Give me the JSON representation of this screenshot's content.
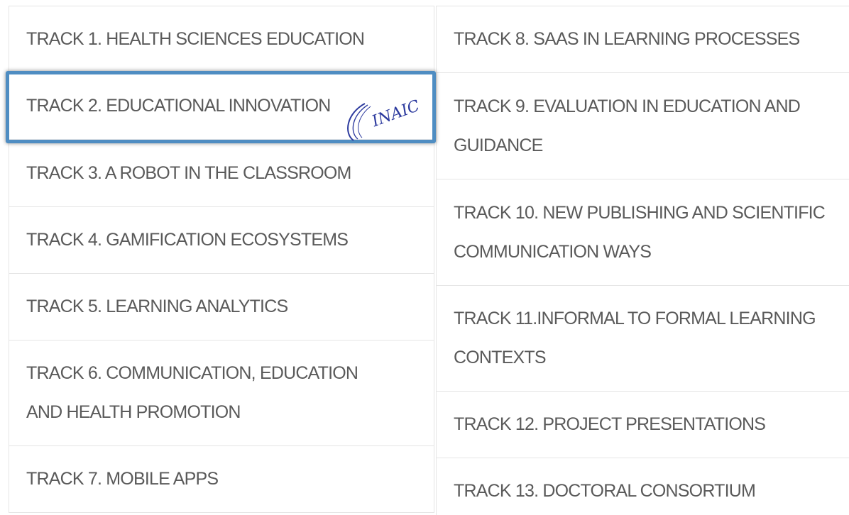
{
  "tracks_left": [
    {
      "label": "TRACK 1. HEALTH SCIENCES EDUCATION"
    },
    {
      "label": "TRACK 2. EDUCATIONAL INNOVATION"
    },
    {
      "label": "TRACK 3. A ROBOT IN THE CLASSROOM"
    },
    {
      "label": "TRACK 4. GAMIFICATION ECOSYSTEMS"
    },
    {
      "label": "TRACK 5. LEARNING ANALYTICS"
    },
    {
      "label": "TRACK 6. COMMUNICATION, EDUCATION AND HEALTH PROMOTION"
    },
    {
      "label": "TRACK 7. MOBILE APPS"
    }
  ],
  "tracks_right": [
    {
      "label": "TRACK 8. SAAS IN LEARNING PROCESSES"
    },
    {
      "label": "TRACK 9. EVALUATION IN EDUCATION AND GUIDANCE"
    },
    {
      "label": "TRACK 10. NEW PUBLISHING AND SCIENTIFIC COMMUNICATION WAYS"
    },
    {
      "label": "TRACK 11.INFORMAL TO FORMAL LEARNING CONTEXTS"
    },
    {
      "label": "TRACK 12. PROJECT PRESENTATIONS"
    },
    {
      "label": "TRACK 13. DOCTORAL CONSORTIUM"
    }
  ],
  "logo": {
    "text": "INAIC"
  },
  "colors": {
    "highlight_border": "#4f8dc2",
    "text": "#5a5a5a",
    "logo": "#2c3a9e"
  }
}
